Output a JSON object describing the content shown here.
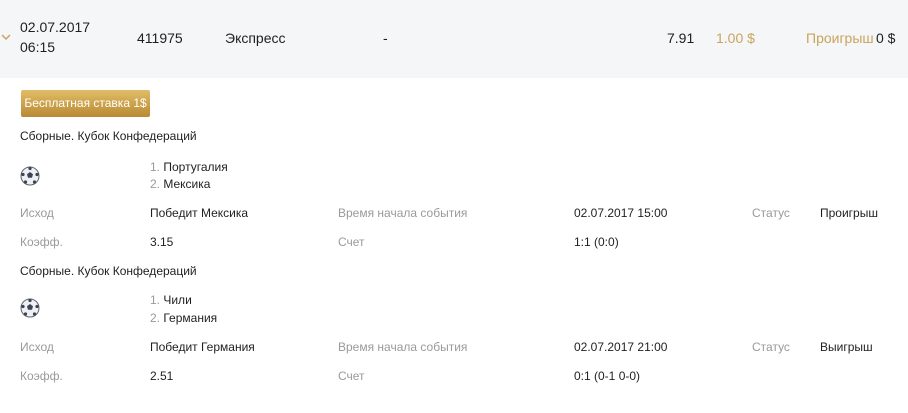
{
  "summary": {
    "date": "02.07.2017",
    "time": "06:15",
    "id": "411975",
    "type": "Экспресс",
    "event": "-",
    "odds": "7.91",
    "stake": "1.00 $",
    "status": "Проигрыш",
    "payout": "0 $"
  },
  "badge": {
    "label": "Бесплатная ставка 1$"
  },
  "labels": {
    "outcome": "Исход",
    "coef": "Коэфф.",
    "start_time": "Время начала события",
    "score": "Счет",
    "status": "Статус"
  },
  "events": [
    {
      "league": "Сборные. Кубок Конфедераций",
      "team1_num": "1.",
      "team1": "Португалия",
      "team2_num": "2.",
      "team2": "Мексика",
      "outcome": "Победит Мексика",
      "coef": "3.15",
      "start_time": "02.07.2017  15:00",
      "score": "1:1 (0:0)",
      "status": "Проигрыш"
    },
    {
      "league": "Сборные. Кубок Конфедераций",
      "team1_num": "1.",
      "team1": "Чили",
      "team2_num": "2.",
      "team2": "Германия",
      "outcome": "Победит Германия",
      "coef": "2.51",
      "start_time": "02.07.2017  21:00",
      "score": "0:1 (0-1 0-0)",
      "status": "Выигрыш"
    }
  ],
  "colors": {
    "gold": "#c9a45c",
    "summary_bg": "#f5f6f8",
    "label_gray": "#9a9a9a"
  },
  "icons": {
    "expand": "chevron-down-icon",
    "sport": "soccer-ball-icon"
  }
}
